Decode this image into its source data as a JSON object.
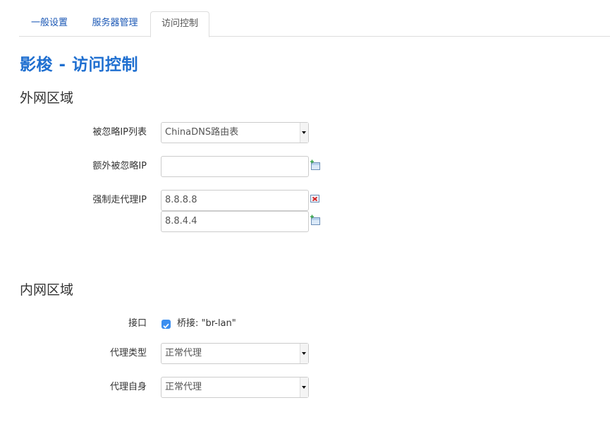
{
  "tabs": [
    "一般设置",
    "服务器管理",
    "访问控制"
  ],
  "page_title": "影梭 - 访问控制",
  "wan": {
    "section_title": "外网区域",
    "ignore_list": {
      "label": "被忽略IP列表",
      "value": "ChinaDNS路由表"
    },
    "extra_ignore": {
      "label": "额外被忽略IP",
      "value": ""
    },
    "force_proxy": {
      "label": "强制走代理IP",
      "values": [
        "8.8.8.8",
        "8.8.4.4"
      ]
    }
  },
  "lan": {
    "section_title": "内网区域",
    "interface": {
      "label": "接口",
      "checkbox_label": "桥接: \"br-lan\"",
      "checked": true
    },
    "proxy_type": {
      "label": "代理类型",
      "value": "正常代理"
    },
    "self_proxy": {
      "label": "代理自身",
      "value": "正常代理"
    }
  },
  "icons": {
    "add": "add-icon",
    "remove": "remove-icon",
    "dropdown": "chevron-down-icon"
  },
  "colors": {
    "accent": "#1f6fd0",
    "tab_link": "#1a57b5",
    "checkbox": "#3b8ef0"
  }
}
